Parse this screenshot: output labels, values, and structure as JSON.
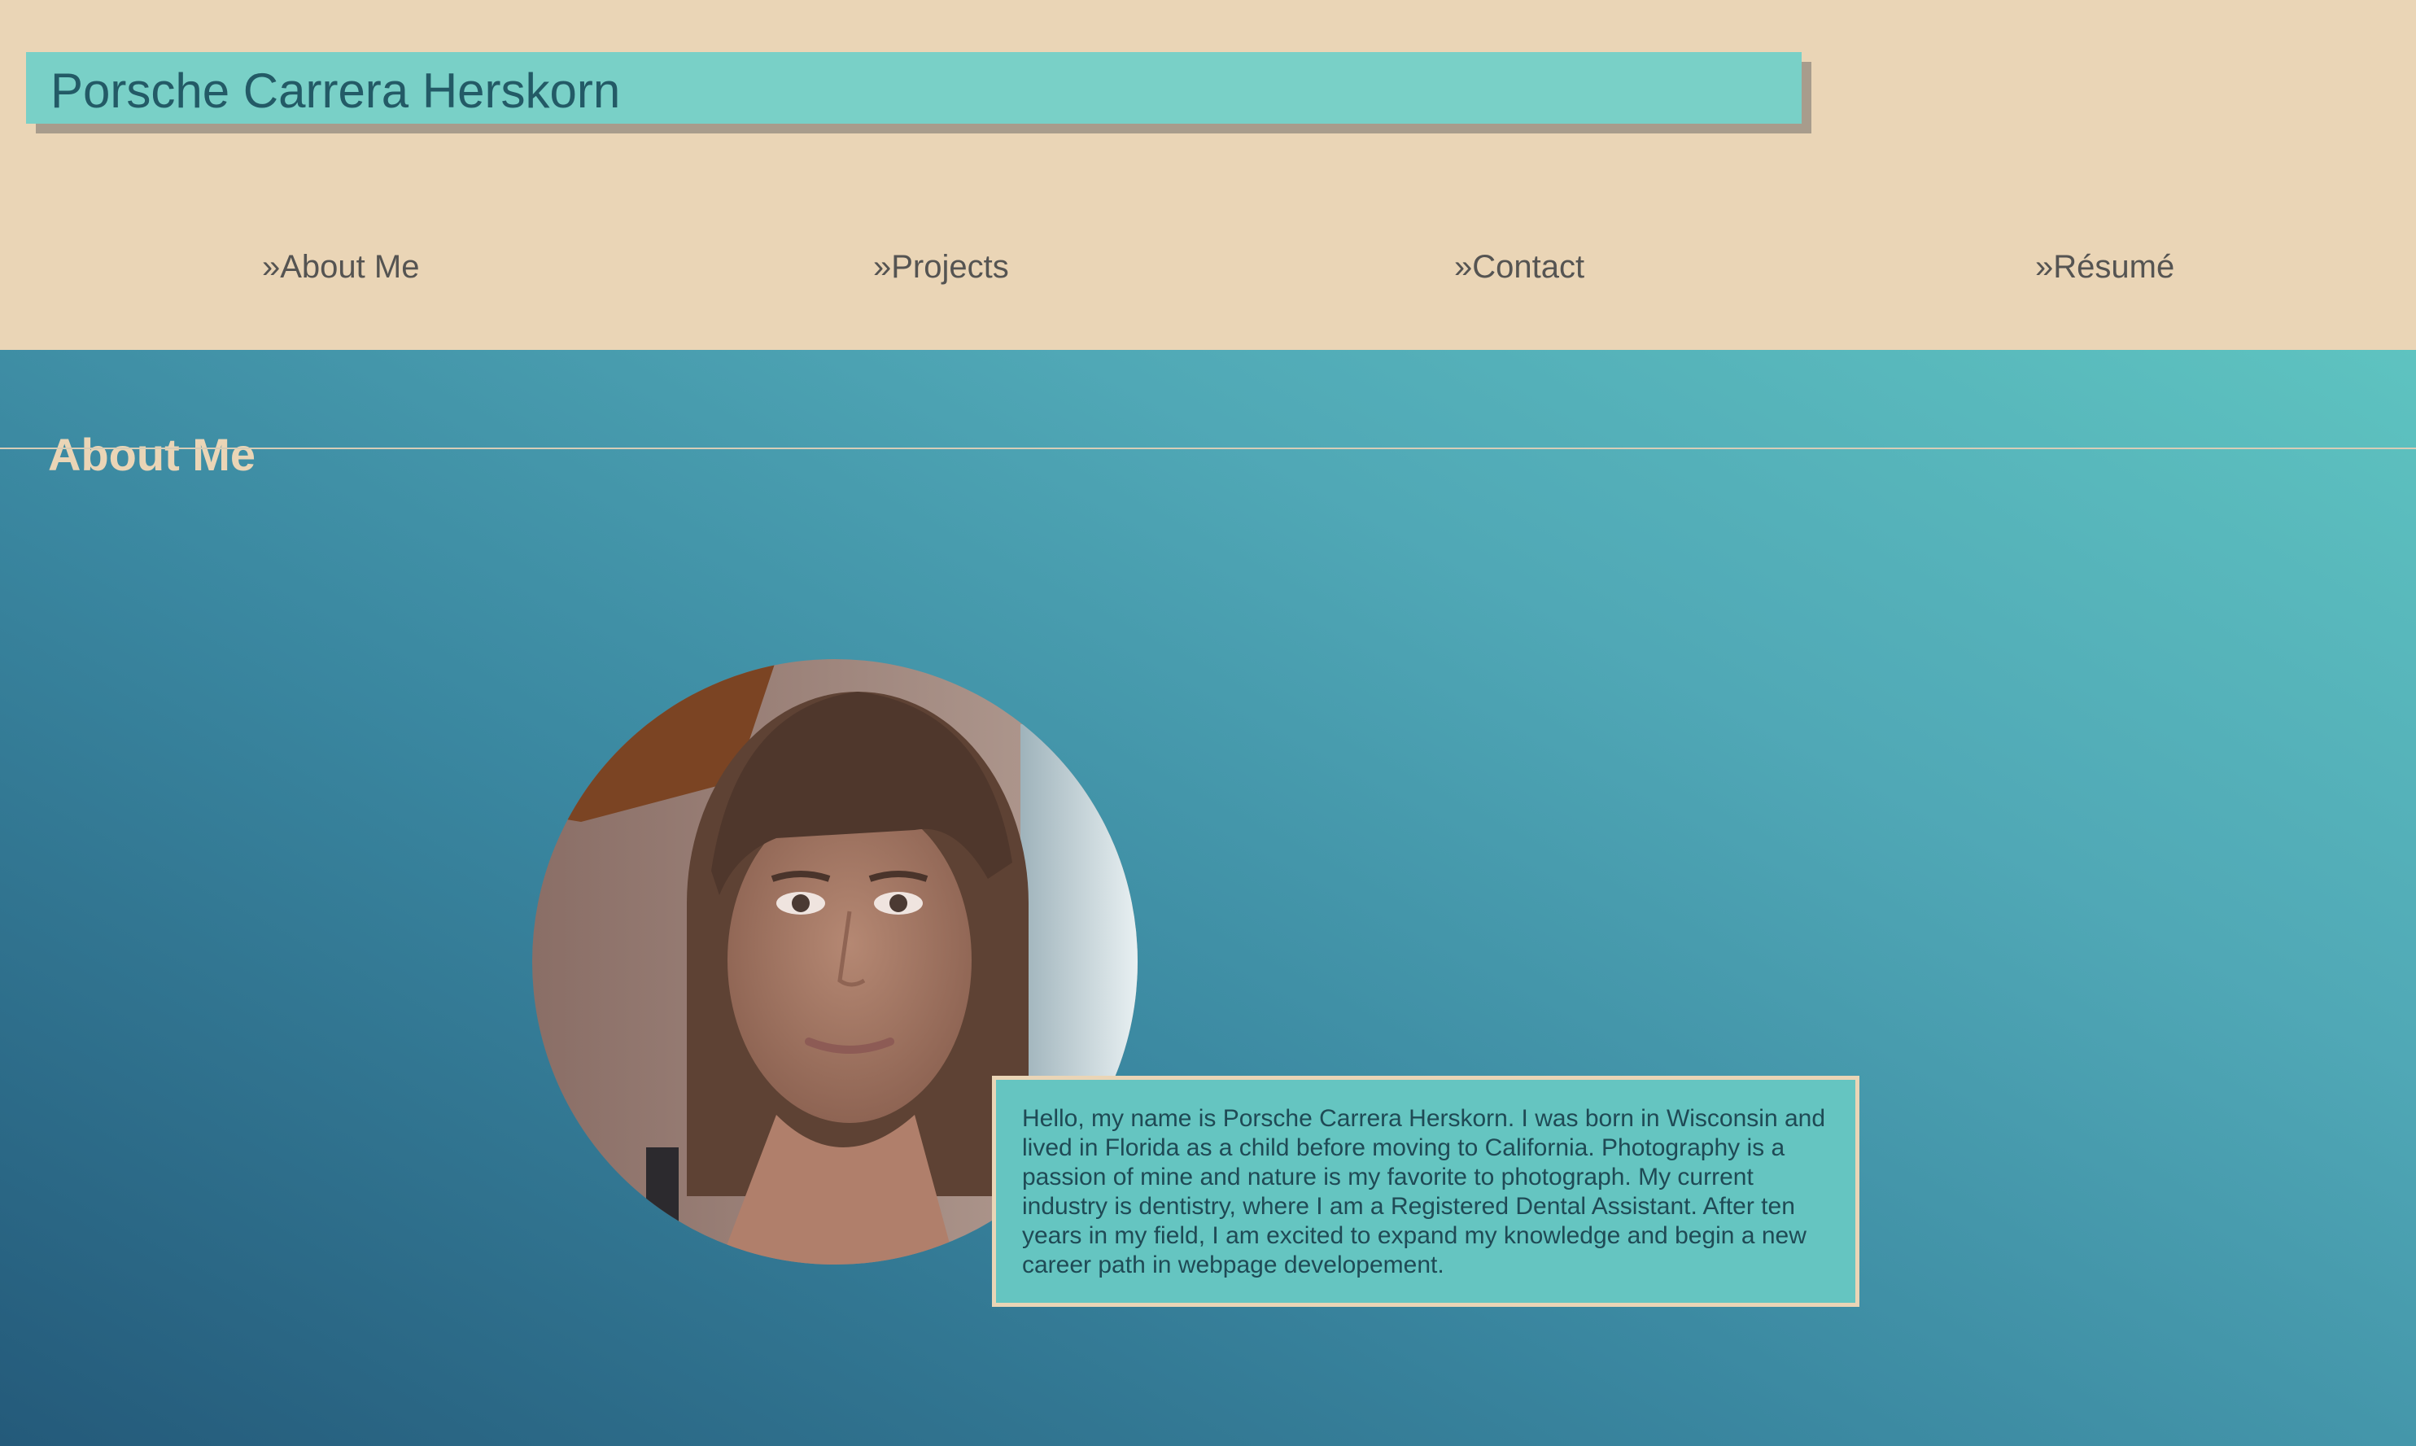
{
  "site": {
    "name": "Porsche Carrera Herskorn"
  },
  "nav": {
    "items": [
      {
        "label": "»About Me"
      },
      {
        "label": "»Projects"
      },
      {
        "label": "»Contact"
      },
      {
        "label": "»Résumé"
      }
    ]
  },
  "section": {
    "title": "About Me"
  },
  "bio": {
    "text": "Hello, my name is Porsche Carrera Herskorn. I was born in Wisconsin and lived in Florida as a child before moving to California. Photography is a passion of mine and nature is my favorite to photograph. My current industry is dentistry, where I am a Registered Dental Assistant. After ten years in my field, I am excited to expand my knowledge and begin a new career path in webpage developement."
  },
  "colors": {
    "header_bg": "#ead5b6",
    "title_box": "#79d0c7",
    "title_text": "#235a66",
    "nav_text": "#555452",
    "gradient_dark": "#245a7a",
    "gradient_light": "#5ec3c0",
    "bio_box": "#65c5c1"
  },
  "icons": {
    "portrait": "profile-photo"
  }
}
